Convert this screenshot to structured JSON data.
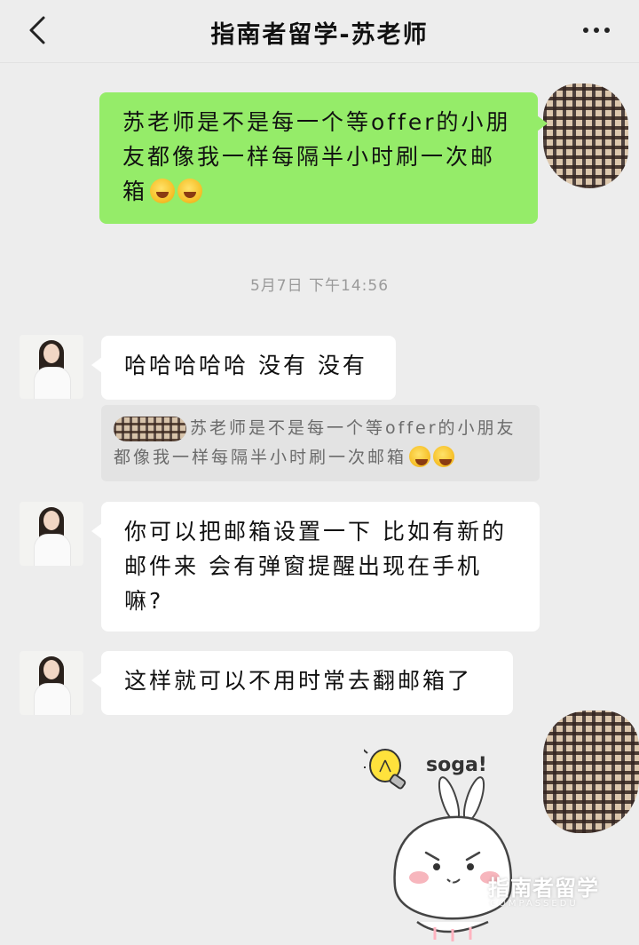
{
  "header": {
    "title": "指南者留学-苏老师"
  },
  "messages": {
    "m1": "苏老师是不是每一个等offer的小朋友都像我一样每隔半小时刷一次邮箱",
    "timestamp": "5月7日 下午14:56",
    "m2": "哈哈哈哈哈 没有 没有",
    "quote": "苏老师是不是每一个等offer的小朋友都像我一样每隔半小时刷一次邮箱",
    "m3": "你可以把邮箱设置一下 比如有新的邮件来 会有弹窗提醒出现在手机嘛?",
    "m4": "这样就可以不用时常去翻邮箱了"
  },
  "sticker": {
    "text": "soga!"
  },
  "watermark": {
    "text": "指南者留学",
    "sub": "COMPASSEDU"
  },
  "icons": [
    "chevron-left-icon",
    "more-icon",
    "emoji-laugh-cry-icon",
    "lightbulb-icon"
  ]
}
